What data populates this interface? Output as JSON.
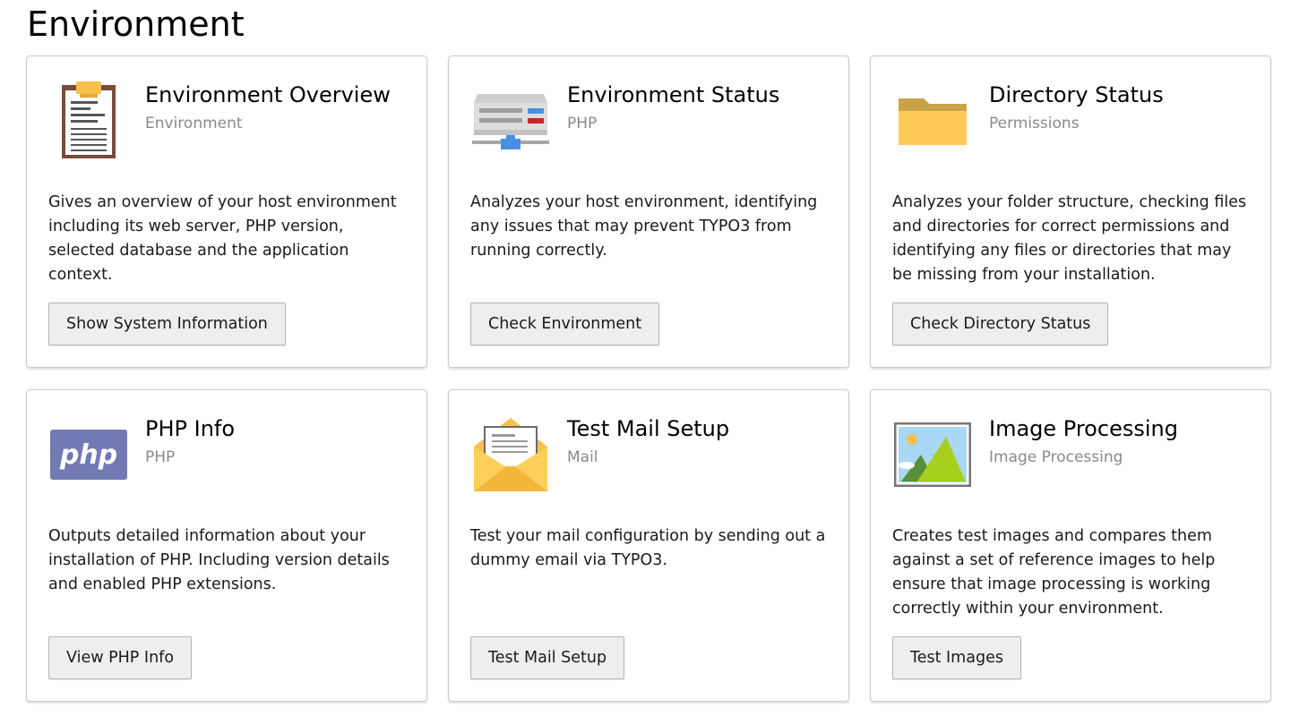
{
  "page": {
    "title": "Environment"
  },
  "cards": [
    {
      "icon": "clipboard-icon",
      "title": "Environment Overview",
      "subtitle": "Environment",
      "description": "Gives an overview of your host environment including its web server, PHP version, selected database and the application context.",
      "button": "Show System Information"
    },
    {
      "icon": "server-icon",
      "title": "Environment Status",
      "subtitle": "PHP",
      "description": "Analyzes your host environment, identifying any issues that may prevent TYPO3 from running correctly.",
      "button": "Check Environment"
    },
    {
      "icon": "folder-icon",
      "title": "Directory Status",
      "subtitle": "Permissions",
      "description": "Analyzes your folder structure, checking files and directories for correct permissions and identifying any files or directories that may be missing from your installation.",
      "button": "Check Directory Status"
    },
    {
      "icon": "php-logo-icon",
      "title": "PHP Info",
      "subtitle": "PHP",
      "description": "Outputs detailed information about your installation of PHP. Including version details and enabled PHP extensions.",
      "button": "View PHP Info"
    },
    {
      "icon": "mail-envelope-icon",
      "title": "Test Mail Setup",
      "subtitle": "Mail",
      "description": "Test your mail configuration by sending out a dummy email via TYPO3.",
      "button": "Test Mail Setup"
    },
    {
      "icon": "image-picture-icon",
      "title": "Image Processing",
      "subtitle": "Image Processing",
      "description": "Creates test images and compares them against a set of reference images to help ensure that image processing is working correctly within your environment.",
      "button": "Test Images"
    }
  ],
  "php_logo_text": "php"
}
